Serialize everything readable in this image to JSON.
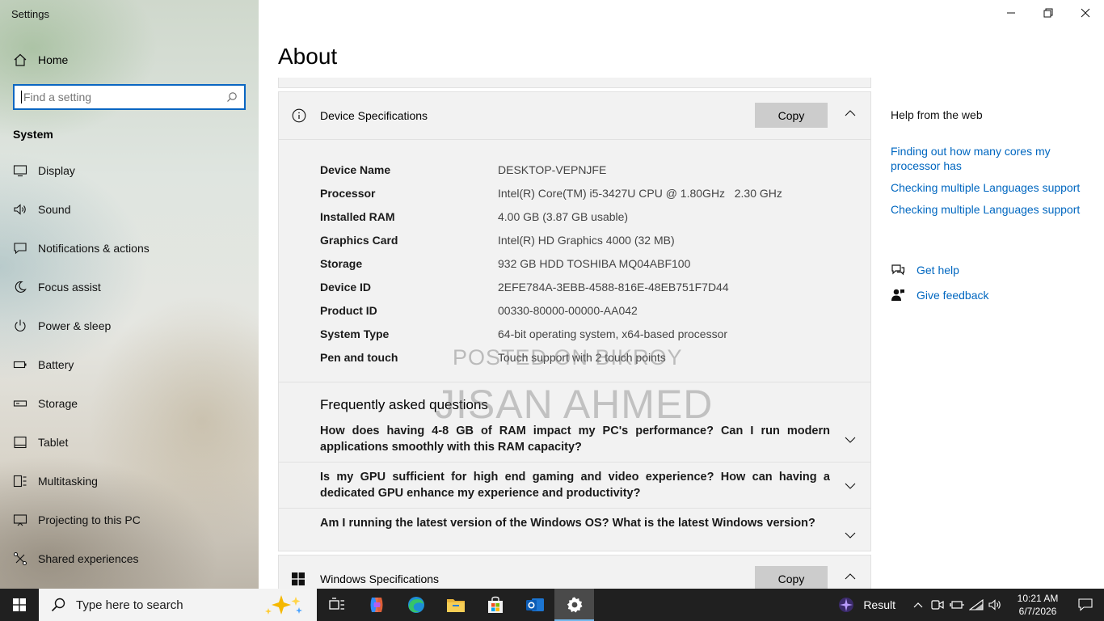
{
  "window": {
    "app_title": "Settings"
  },
  "sidebar": {
    "home_label": "Home",
    "search_placeholder": "Find a setting",
    "section": "System",
    "items": [
      {
        "label": "Display",
        "icon": "display-icon"
      },
      {
        "label": "Sound",
        "icon": "sound-icon"
      },
      {
        "label": "Notifications & actions",
        "icon": "notifications-icon"
      },
      {
        "label": "Focus assist",
        "icon": "focus-assist-icon"
      },
      {
        "label": "Power & sleep",
        "icon": "power-icon"
      },
      {
        "label": "Battery",
        "icon": "battery-icon"
      },
      {
        "label": "Storage",
        "icon": "storage-icon"
      },
      {
        "label": "Tablet",
        "icon": "tablet-icon"
      },
      {
        "label": "Multitasking",
        "icon": "multitasking-icon"
      },
      {
        "label": "Projecting to this PC",
        "icon": "projecting-icon"
      },
      {
        "label": "Shared experiences",
        "icon": "shared-experiences-icon"
      }
    ]
  },
  "main": {
    "title": "About",
    "device_specs": {
      "title": "Device Specifications",
      "copy_label": "Copy",
      "rows": [
        {
          "key": "Device Name",
          "value": "DESKTOP-VEPNJFE"
        },
        {
          "key": "Processor",
          "value": "Intel(R) Core(TM) i5-3427U CPU @ 1.80GHz   2.30 GHz"
        },
        {
          "key": "Installed RAM",
          "value": "4.00 GB (3.87 GB usable)"
        },
        {
          "key": "Graphics Card",
          "value": "Intel(R) HD Graphics 4000 (32 MB)"
        },
        {
          "key": "Storage",
          "value": "932 GB HDD TOSHIBA MQ04ABF100"
        },
        {
          "key": "Device ID",
          "value": "2EFE784A-3EBB-4588-816E-48EB751F7D44"
        },
        {
          "key": "Product ID",
          "value": "00330-80000-00000-AA042"
        },
        {
          "key": "System Type",
          "value": "64-bit operating system, x64-based processor"
        },
        {
          "key": "Pen and touch",
          "value": "Touch support with 2 touch points"
        }
      ]
    },
    "faq": {
      "title": "Frequently asked questions",
      "items": [
        "How does having 4-8 GB of RAM impact my PC's performance? Can I run modern applications smoothly with this RAM capacity?",
        "Is my GPU sufficient for high end gaming and video experience? How can having a dedicated GPU enhance my experience and productivity?",
        "Am I running the latest version of the Windows OS? What is the latest Windows version?"
      ]
    },
    "windows_specs": {
      "title": "Windows Specifications",
      "copy_label": "Copy"
    },
    "watermark": {
      "line1": "POSTED ON BIKROY",
      "line2": "JISAN AHMED"
    }
  },
  "help": {
    "title": "Help from the web",
    "links": [
      "Finding out how many cores my processor has",
      "Checking multiple Languages support",
      "Checking multiple Languages support"
    ],
    "get_help": "Get help",
    "give_feedback": "Give feedback"
  },
  "taskbar": {
    "search_placeholder": "Type here to search",
    "tray_label": "Result",
    "time": "10:21 AM",
    "date": "6/7/2026"
  },
  "colors": {
    "accent": "#0067c0",
    "taskbar": "#202020",
    "panel": "#f2f2f2"
  }
}
